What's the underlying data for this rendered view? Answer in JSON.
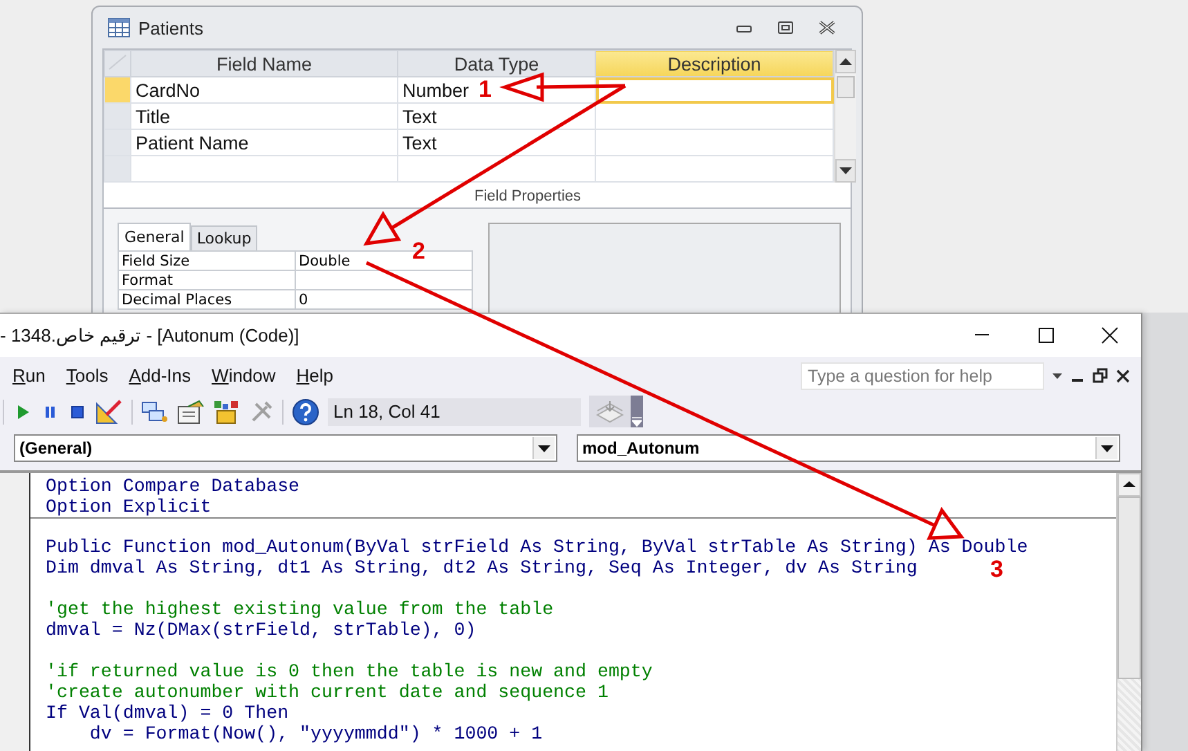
{
  "design_window": {
    "title": "Patients",
    "columns": [
      {
        "label": "Field Name",
        "selected": false
      },
      {
        "label": "Data Type",
        "selected": false
      },
      {
        "label": "Description",
        "selected": true
      }
    ],
    "rows": [
      {
        "field_name": "CardNo",
        "data_type": "Number",
        "selected": true
      },
      {
        "field_name": "Title",
        "data_type": "Text",
        "selected": false
      },
      {
        "field_name": "Patient Name",
        "data_type": "Text",
        "selected": false
      },
      {
        "selected": false
      }
    ],
    "section_label": "Field Properties",
    "tabs": [
      {
        "label": "General",
        "selected": true
      },
      {
        "label": "Lookup",
        "selected": false
      }
    ],
    "properties": [
      {
        "name": "Field Size",
        "value": "Double"
      },
      {
        "name": "Format"
      },
      {
        "name": "Decimal Places",
        "value": "0"
      }
    ]
  },
  "vba_window": {
    "title": "- ترقيم خاص.1348 - [Autonum (Code)]",
    "menu": [
      "Run",
      "Tools",
      "Add-Ins",
      "Window",
      "Help"
    ],
    "help_search": {
      "placeholder": "Type a question for help"
    },
    "cursor_position": "Ln 18, Col 41",
    "object_dropdown": "(General)",
    "procedure_dropdown": "mod_Autonum",
    "code_sections": [
      {
        "lines": [
          {
            "kind": "code",
            "text": "Option Compare Database"
          },
          {
            "kind": "code",
            "text": "Option Explicit"
          }
        ]
      },
      {
        "lines": [
          {
            "kind": "code",
            "text": "Public Function mod_Autonum(ByVal strField As String, ByVal strTable As String) As Double"
          },
          {
            "kind": "code",
            "text": "Dim dmval As String, dt1 As String, dt2 As String, Seq As Integer, dv As String"
          },
          {
            "kind": "blank"
          },
          {
            "kind": "comment",
            "text": "'get the highest existing value from the table"
          },
          {
            "kind": "code",
            "text": "dmval = Nz(DMax(strField, strTable), 0)"
          },
          {
            "kind": "blank"
          },
          {
            "kind": "comment",
            "text": "'if returned value is 0 then the table is new and empty"
          },
          {
            "kind": "comment",
            "text": "'create autonumber with current date and sequence 1"
          },
          {
            "kind": "code",
            "text": "If Val(dmval) = 0 Then"
          },
          {
            "kind": "code",
            "text": "    dv = Format(Now(), \"yyyymmdd\") * 1000 + 1"
          }
        ]
      }
    ]
  },
  "annotations": [
    {
      "label": "1"
    },
    {
      "label": "2"
    },
    {
      "label": "3"
    }
  ]
}
